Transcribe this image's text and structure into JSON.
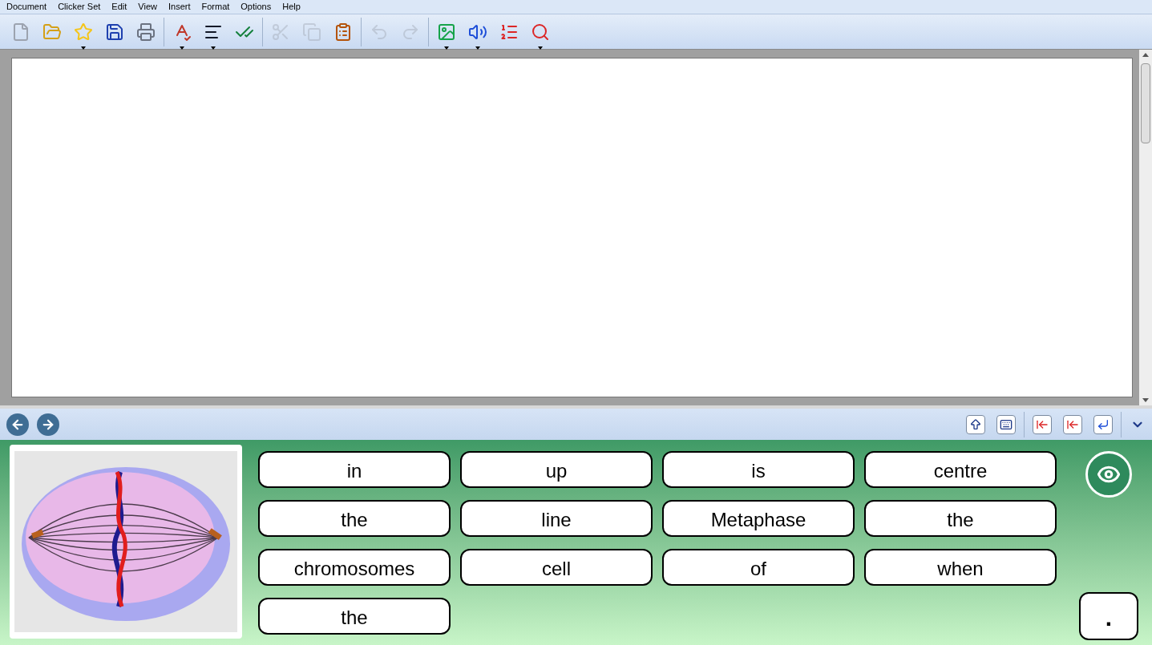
{
  "menu": [
    "Document",
    "Clicker Set",
    "Edit",
    "View",
    "Insert",
    "Format",
    "Options",
    "Help"
  ],
  "toolbar": [
    [
      {
        "kind": "new",
        "disabled": false
      },
      {
        "kind": "open",
        "disabled": false
      },
      {
        "kind": "star",
        "disabled": false
      },
      {
        "kind": "save",
        "disabled": false
      },
      {
        "kind": "print",
        "disabled": false
      }
    ],
    [
      {
        "kind": "spelling",
        "disabled": false
      },
      {
        "kind": "lines",
        "disabled": false
      },
      {
        "kind": "check",
        "disabled": false
      }
    ],
    [
      {
        "kind": "cut",
        "disabled": true
      },
      {
        "kind": "copy",
        "disabled": true
      },
      {
        "kind": "paste",
        "disabled": false
      }
    ],
    [
      {
        "kind": "undo",
        "disabled": true
      },
      {
        "kind": "redo",
        "disabled": true
      }
    ],
    [
      {
        "kind": "picture",
        "disabled": false
      },
      {
        "kind": "speech",
        "disabled": false
      },
      {
        "kind": "list",
        "disabled": false
      },
      {
        "kind": "search",
        "disabled": false
      }
    ]
  ],
  "words": [
    "in",
    "up",
    "is",
    "centre",
    "the",
    "line",
    "Metaphase",
    "the",
    "chromosomes",
    "cell",
    "of",
    "when",
    "the"
  ],
  "punctuation": "."
}
